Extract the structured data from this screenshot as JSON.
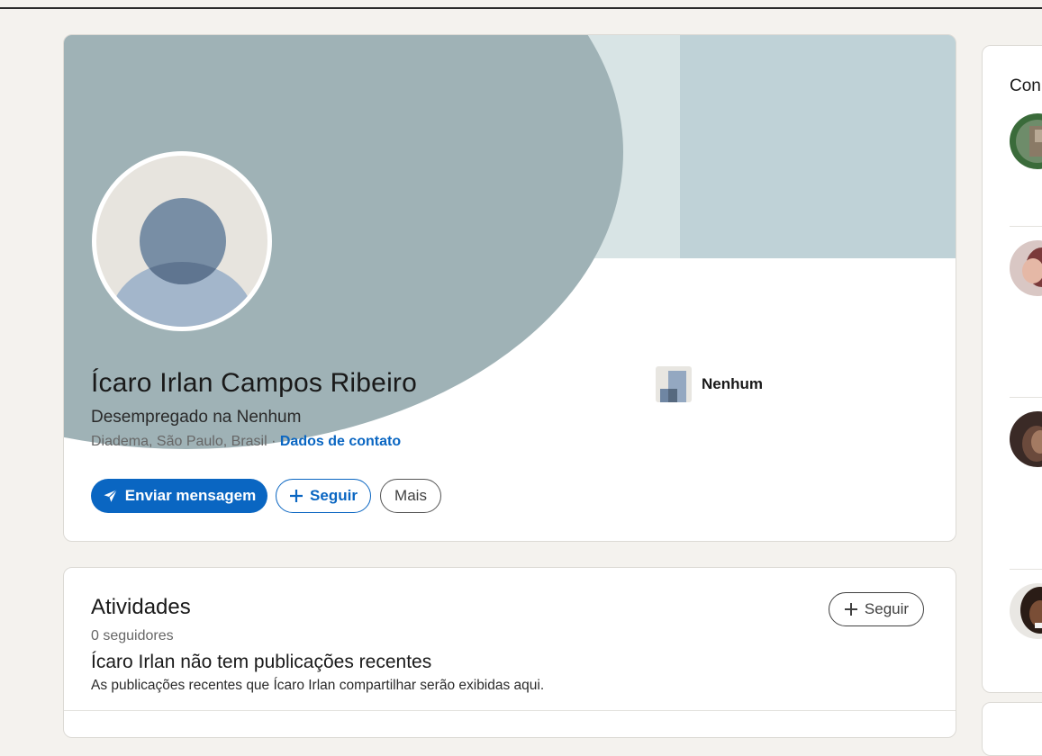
{
  "profile": {
    "name": "Ícaro Irlan Campos Ribeiro",
    "headline": "Desempregado na Nenhum",
    "location": "Diadema, São Paulo, Brasil",
    "separator": " · ",
    "contact_link": "Dados de contato",
    "company": "Nenhum",
    "buttons": {
      "message": "Enviar mensagem",
      "follow": "Seguir",
      "more": "Mais"
    }
  },
  "activity": {
    "title": "Atividades",
    "followers": "0 seguidores",
    "follow_button": "Seguir",
    "empty_title": "Ícaro Irlan não tem publicações recentes",
    "empty_desc": "As publicações recentes que Ícaro Irlan compartilhar serão exibidas aqui."
  },
  "sidebar": {
    "title": "Con"
  },
  "colors": {
    "primary": "#0a66c2",
    "background": "#f4f2ee"
  }
}
